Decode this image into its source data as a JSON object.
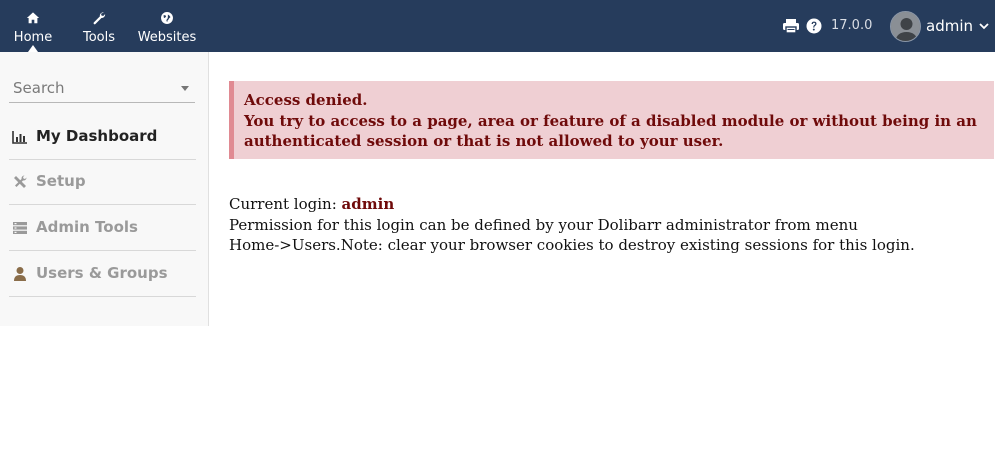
{
  "topbar": {
    "nav": [
      {
        "label": "Home",
        "icon": "home-icon"
      },
      {
        "label": "Tools",
        "icon": "wrench-icon"
      },
      {
        "label": "Websites",
        "icon": "globe-icon"
      }
    ],
    "version": "17.0.0",
    "username": "admin",
    "background": "#263c5c"
  },
  "sidebar": {
    "search_placeholder": "Search",
    "items": [
      {
        "label": "My Dashboard",
        "icon": "bar-chart-icon",
        "active": true
      },
      {
        "label": "Setup",
        "icon": "tools-icon",
        "active": false
      },
      {
        "label": "Admin Tools",
        "icon": "server-icon",
        "active": false
      },
      {
        "label": "Users & Groups",
        "icon": "user-icon",
        "active": false
      }
    ]
  },
  "main": {
    "alert": {
      "title": "Access denied.",
      "message": "You try to access to a page, area or feature of a disabled module or without being in an authenticated session or that is not allowed to your user."
    },
    "current_login_label": "Current login:",
    "current_login_value": "admin",
    "permission_line1": "Permission for this login can be defined by your Dolibarr administrator from menu",
    "permission_line2": "Home->Users.Note: clear your browser cookies to destroy existing sessions for this login."
  },
  "colors": {
    "alert_bg": "#efcfd3",
    "alert_text": "#6f0a0a",
    "alert_border": "#e08a92"
  }
}
